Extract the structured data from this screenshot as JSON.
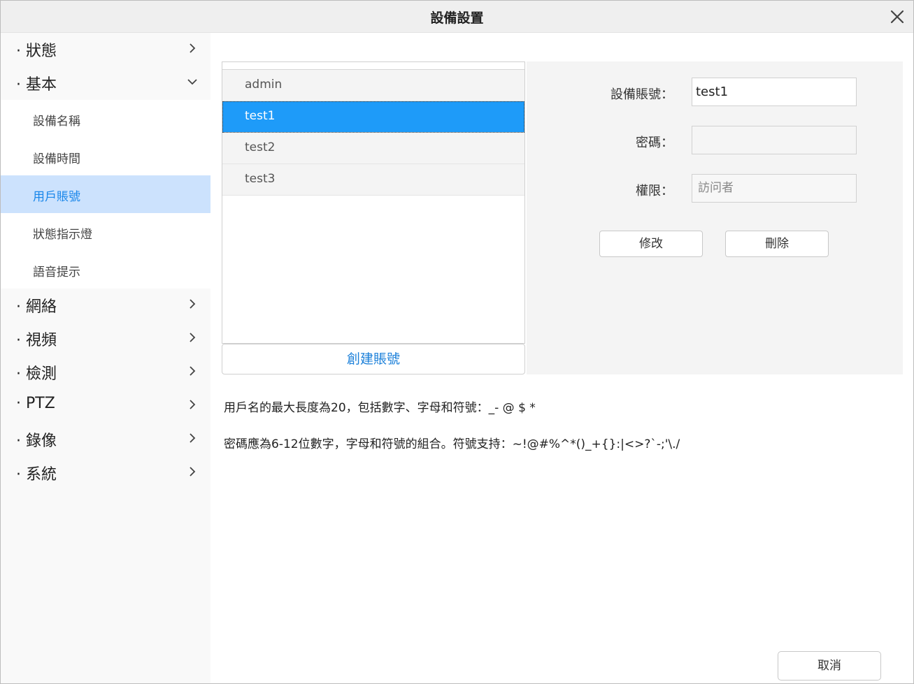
{
  "window": {
    "title": "設備設置"
  },
  "sidebar": {
    "groups_top": [
      {
        "label": "· 狀態",
        "expanded": false
      },
      {
        "label": "· 基本",
        "expanded": true
      }
    ],
    "sub_items": [
      {
        "label": "設備名稱"
      },
      {
        "label": "設備時間"
      },
      {
        "label": "用戶賬號",
        "active": true
      },
      {
        "label": "狀態指示燈"
      },
      {
        "label": "語音提示"
      }
    ],
    "groups_bottom": [
      {
        "label": "· 網絡"
      },
      {
        "label": "· 視頻"
      },
      {
        "label": "· 檢測"
      },
      {
        "label": "· PTZ"
      },
      {
        "label": "· 錄像"
      },
      {
        "label": "· 系統"
      }
    ]
  },
  "user_list": {
    "items": [
      {
        "label": "admin"
      },
      {
        "label": "test1",
        "selected": true
      },
      {
        "label": "test2"
      },
      {
        "label": "test3"
      }
    ],
    "create_label": "創建賬號"
  },
  "detail": {
    "account_label": "設備賬號：",
    "account_value": "test1",
    "password_label": "密碼：",
    "password_value": "",
    "permission_label": "權限：",
    "permission_placeholder": "訪问者",
    "modify_label": "修改",
    "delete_label": "刪除"
  },
  "notes": {
    "line1": "用戶名的最大長度為20，包括數字、字母和符號：_- @ $ *",
    "line2": "密碼應為6-12位數字，字母和符號的組合。符號支持：~!@#%^*()_+{}:|<>?`-;'\\./"
  },
  "footer": {
    "cancel_label": "取消"
  },
  "colors": {
    "accent": "#1e9bf9",
    "active_bg": "#cce2fd",
    "link": "#1a7fd9"
  }
}
